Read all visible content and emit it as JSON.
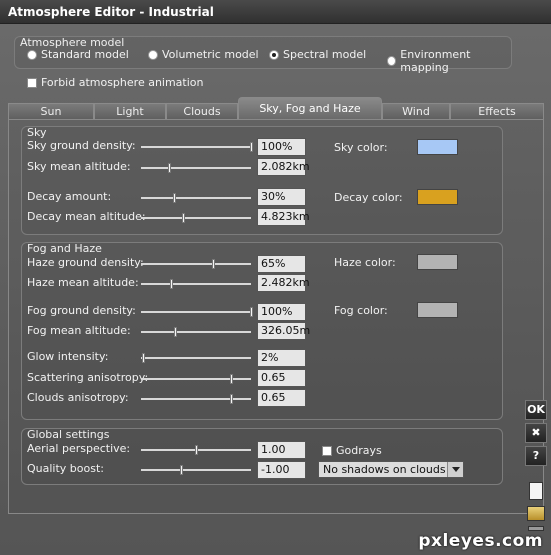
{
  "window": {
    "title": "Atmosphere Editor - Industrial"
  },
  "atmosphere_model": {
    "title": "Atmosphere model",
    "options": [
      "Standard model",
      "Volumetric model",
      "Spectral model",
      "Environment mapping"
    ],
    "selected": "Spectral model"
  },
  "forbid_animation": {
    "label": "Forbid atmosphere animation",
    "checked": false
  },
  "tabs": {
    "items": [
      "Sun",
      "Light",
      "Clouds",
      "Sky, Fog and Haze",
      "Wind",
      "Effects"
    ],
    "active": "Sky, Fog and Haze"
  },
  "sky": {
    "title": "Sky",
    "ground_density": {
      "label": "Sky ground density:",
      "value": "100%",
      "level": 1.0
    },
    "mean_altitude": {
      "label": "Sky mean altitude:",
      "value": "2.082km",
      "level": 0.25
    },
    "decay_amount": {
      "label": "Decay amount:",
      "value": "30%",
      "level": 0.3
    },
    "decay_mean_altitude": {
      "label": "Decay mean altitude:",
      "value": "4.823km",
      "level": 0.38
    },
    "sky_color": {
      "label": "Sky color:",
      "color": "#a7c8f5"
    },
    "decay_color": {
      "label": "Decay color:",
      "color": "#d9a11f"
    }
  },
  "fog": {
    "title": "Fog and Haze",
    "haze_ground_density": {
      "label": "Haze ground density:",
      "value": "65%",
      "level": 0.65
    },
    "haze_mean_altitude": {
      "label": "Haze mean altitude:",
      "value": "2.482km",
      "level": 0.27
    },
    "fog_ground_density": {
      "label": "Fog ground density:",
      "value": "100%",
      "level": 1.0
    },
    "fog_mean_altitude": {
      "label": "Fog mean altitude:",
      "value": "326.05m",
      "level": 0.31
    },
    "glow_intensity": {
      "label": "Glow intensity:",
      "value": "2%",
      "level": 0.02
    },
    "scattering_anisotropy": {
      "label": "Scattering anisotropy:",
      "value": "0.65",
      "level": 0.82
    },
    "clouds_anisotropy": {
      "label": "Clouds anisotropy:",
      "value": "0.65",
      "level": 0.82
    },
    "haze_color": {
      "label": "Haze color:",
      "color": "#b3b3b3"
    },
    "fog_color": {
      "label": "Fog color:",
      "color": "#b3b3b3"
    }
  },
  "global": {
    "title": "Global settings",
    "aerial_perspective": {
      "label": "Aerial perspective:",
      "value": "1.00",
      "level": 0.5
    },
    "quality_boost": {
      "label": "Quality boost:",
      "value": "-1.00",
      "level": 0.36
    },
    "godrays": {
      "label": "Godrays",
      "checked": false
    },
    "shadows": {
      "selected": "No shadows on clouds"
    }
  },
  "side_buttons": {
    "ok": "OK",
    "close": "✖",
    "help": "?"
  },
  "watermark": "pxleyes.com"
}
